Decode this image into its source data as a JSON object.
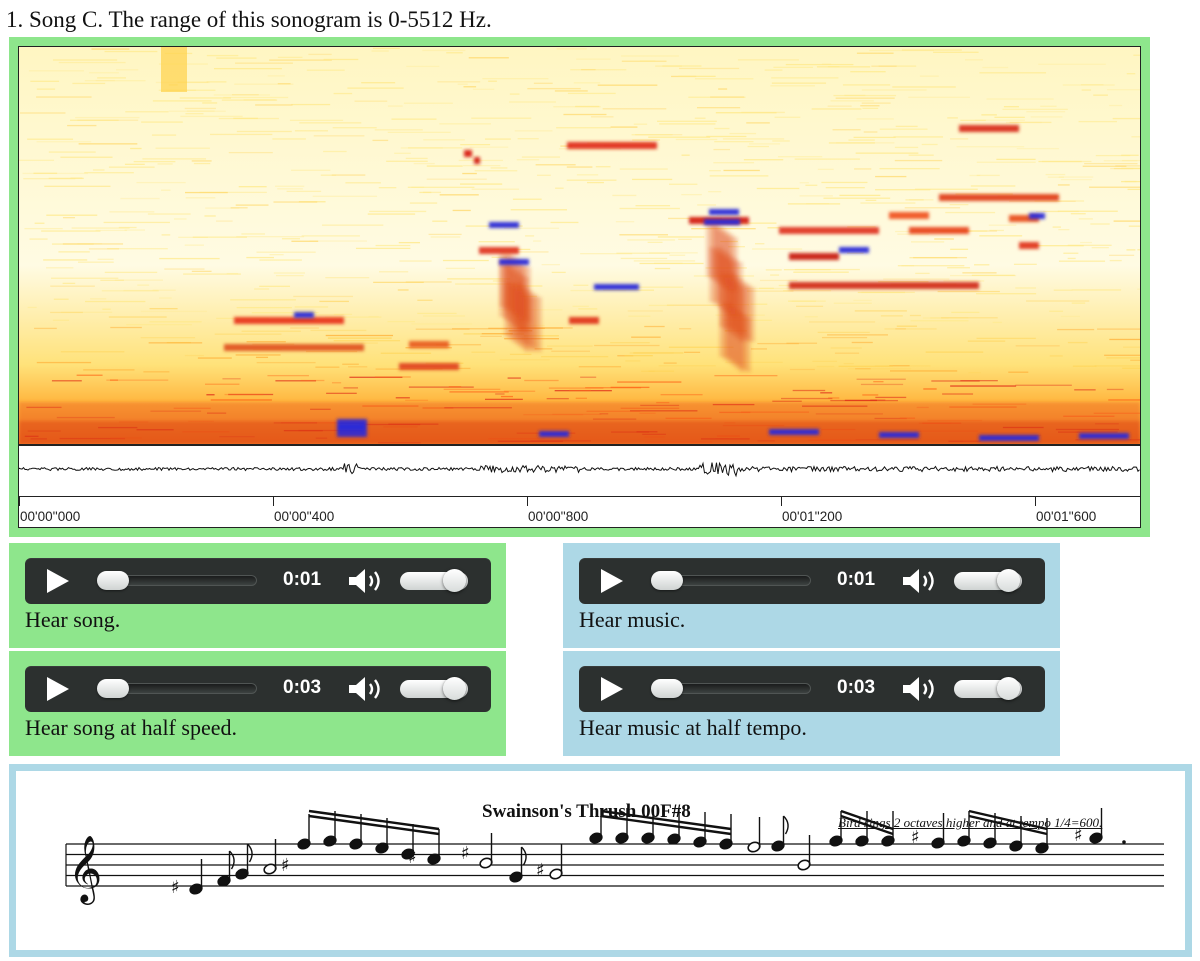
{
  "heading": "1. Song C. The range of this sonogram is 0-5512 Hz.",
  "sonogram": {
    "time_ticks": [
      "00'00''000",
      "00'00''400",
      "00'00''800",
      "00'01''200",
      "00'01''600"
    ]
  },
  "players": [
    {
      "time": "0:01",
      "caption": "Hear song."
    },
    {
      "time": "0:01",
      "caption": "Hear music."
    },
    {
      "time": "0:03",
      "caption": "Hear song at half speed."
    },
    {
      "time": "0:03",
      "caption": "Hear music at half tempo."
    }
  ],
  "score": {
    "title": "Swainson's Thrush 00F#8",
    "note": "Bird sings 2 octaves higher and at tempo 1/4=600."
  },
  "colors": {
    "song_panel": "#8ee68c",
    "music_panel": "#add8e6",
    "player_bg": "#2c302f"
  },
  "icons": [
    "play-icon",
    "volume-icon"
  ]
}
